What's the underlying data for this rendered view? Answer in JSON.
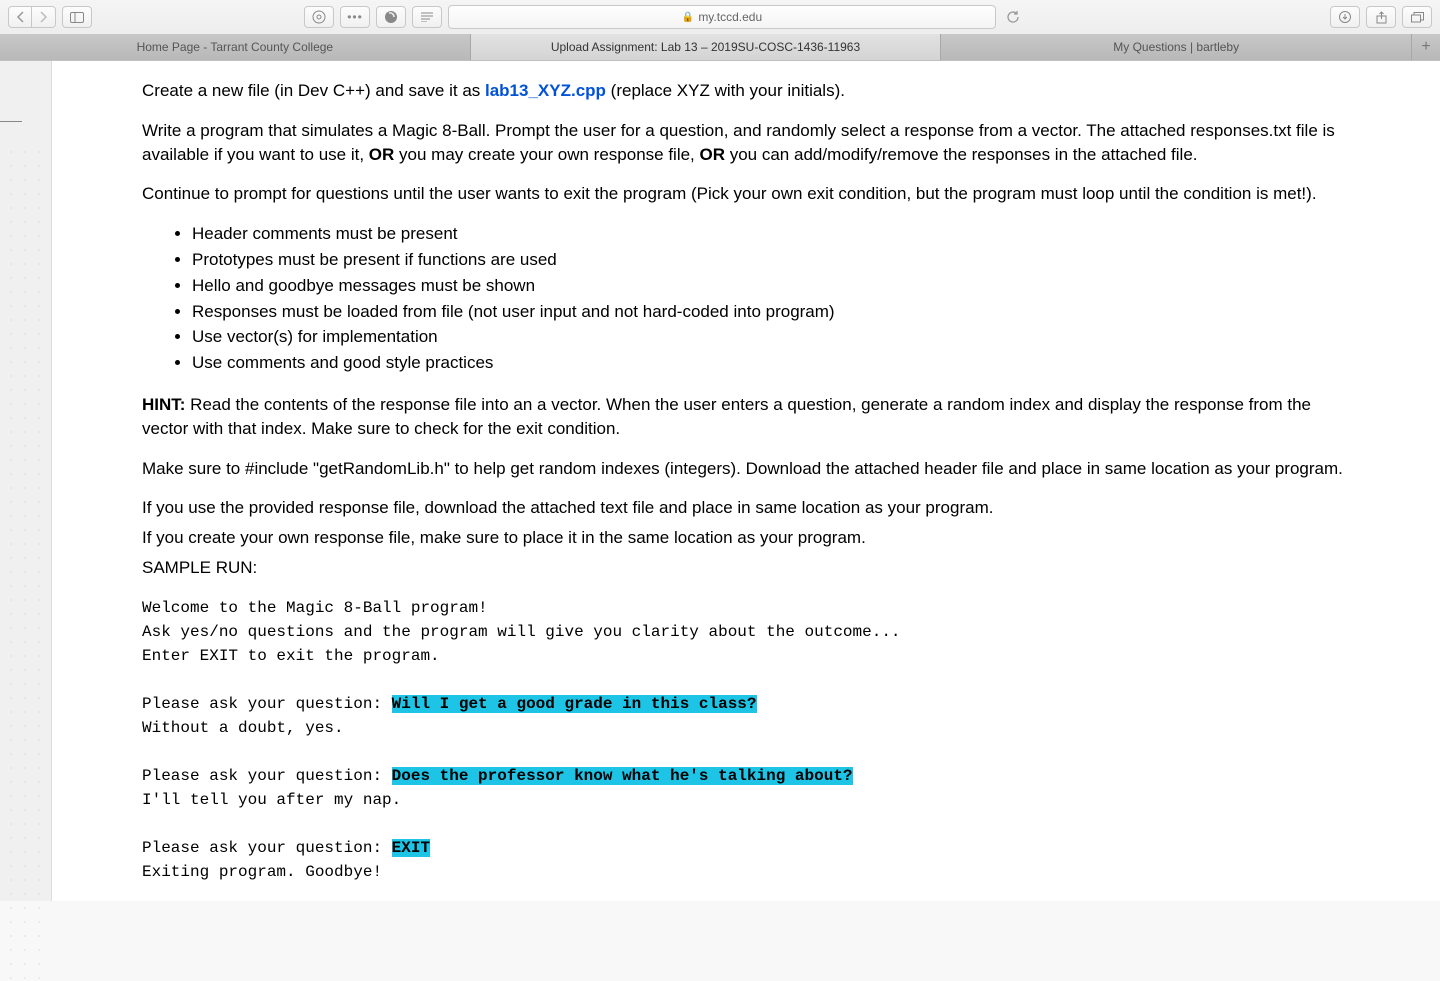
{
  "browser": {
    "url": "my.tccd.edu",
    "tabs": [
      {
        "label": "Home Page - Tarrant County College",
        "active": false
      },
      {
        "label": "Upload Assignment: Lab 13 – 2019SU-COSC-1436-11963",
        "active": true
      },
      {
        "label": "My Questions | bartleby",
        "active": false
      }
    ]
  },
  "content": {
    "p1_prefix": "Create a new file (in Dev C++) and save it as ",
    "p1_filename": "lab13_XYZ.cpp",
    "p1_suffix": " (replace XYZ with your initials).",
    "p2a": "Write a program that simulates a Magic 8-Ball. Prompt the user for a question, and randomly select a response from a vector. The attached responses.txt file is available if you want to use it, ",
    "p2_or1": "OR",
    "p2b": " you may create your own response file, ",
    "p2_or2": "OR",
    "p2c": " you can add/modify/remove the responses in the attached file.",
    "p3": "Continue to prompt for questions until the user wants to exit the program (Pick your own exit condition, but the program must loop until the condition is met!).",
    "requirements": [
      "Header comments must be present",
      "Prototypes must be present if functions are used",
      "Hello and goodbye messages must be shown",
      "Responses must be loaded from file (not user input and not hard-coded into program)",
      "Use vector(s) for implementation",
      "Use comments and good style practices"
    ],
    "hint_label": "HINT:",
    "hint_text": " Read the contents of the response file into an a vector. When the user enters a question, generate a random index and display the response from the vector with that index. Make sure to check for the exit condition.",
    "p5": "Make sure to #include \"getRandomLib.h\" to help get random indexes (integers). Download the attached header file and place in same location as your program.",
    "p6": "If you use the provided response file, download the attached text file and place in same location as your program.",
    "p7": "If you create your own response file, make sure to place it in the same location as your program.",
    "sample_label": "SAMPLE RUN:",
    "sample": {
      "l1": "Welcome to the Magic 8-Ball program!",
      "l2": "Ask yes/no questions and the program will give you clarity about the outcome...",
      "l3": "Enter EXIT to exit the program.",
      "prompt": "Please ask your question: ",
      "q1": "Will I get a good grade in this class?",
      "a1": "Without a doubt, yes.",
      "q2": "Does the professor know what he's talking about?",
      "a2": "I'll tell you after my nap.",
      "q3": "EXIT",
      "exit": "Exiting program. Goodbye!"
    }
  }
}
